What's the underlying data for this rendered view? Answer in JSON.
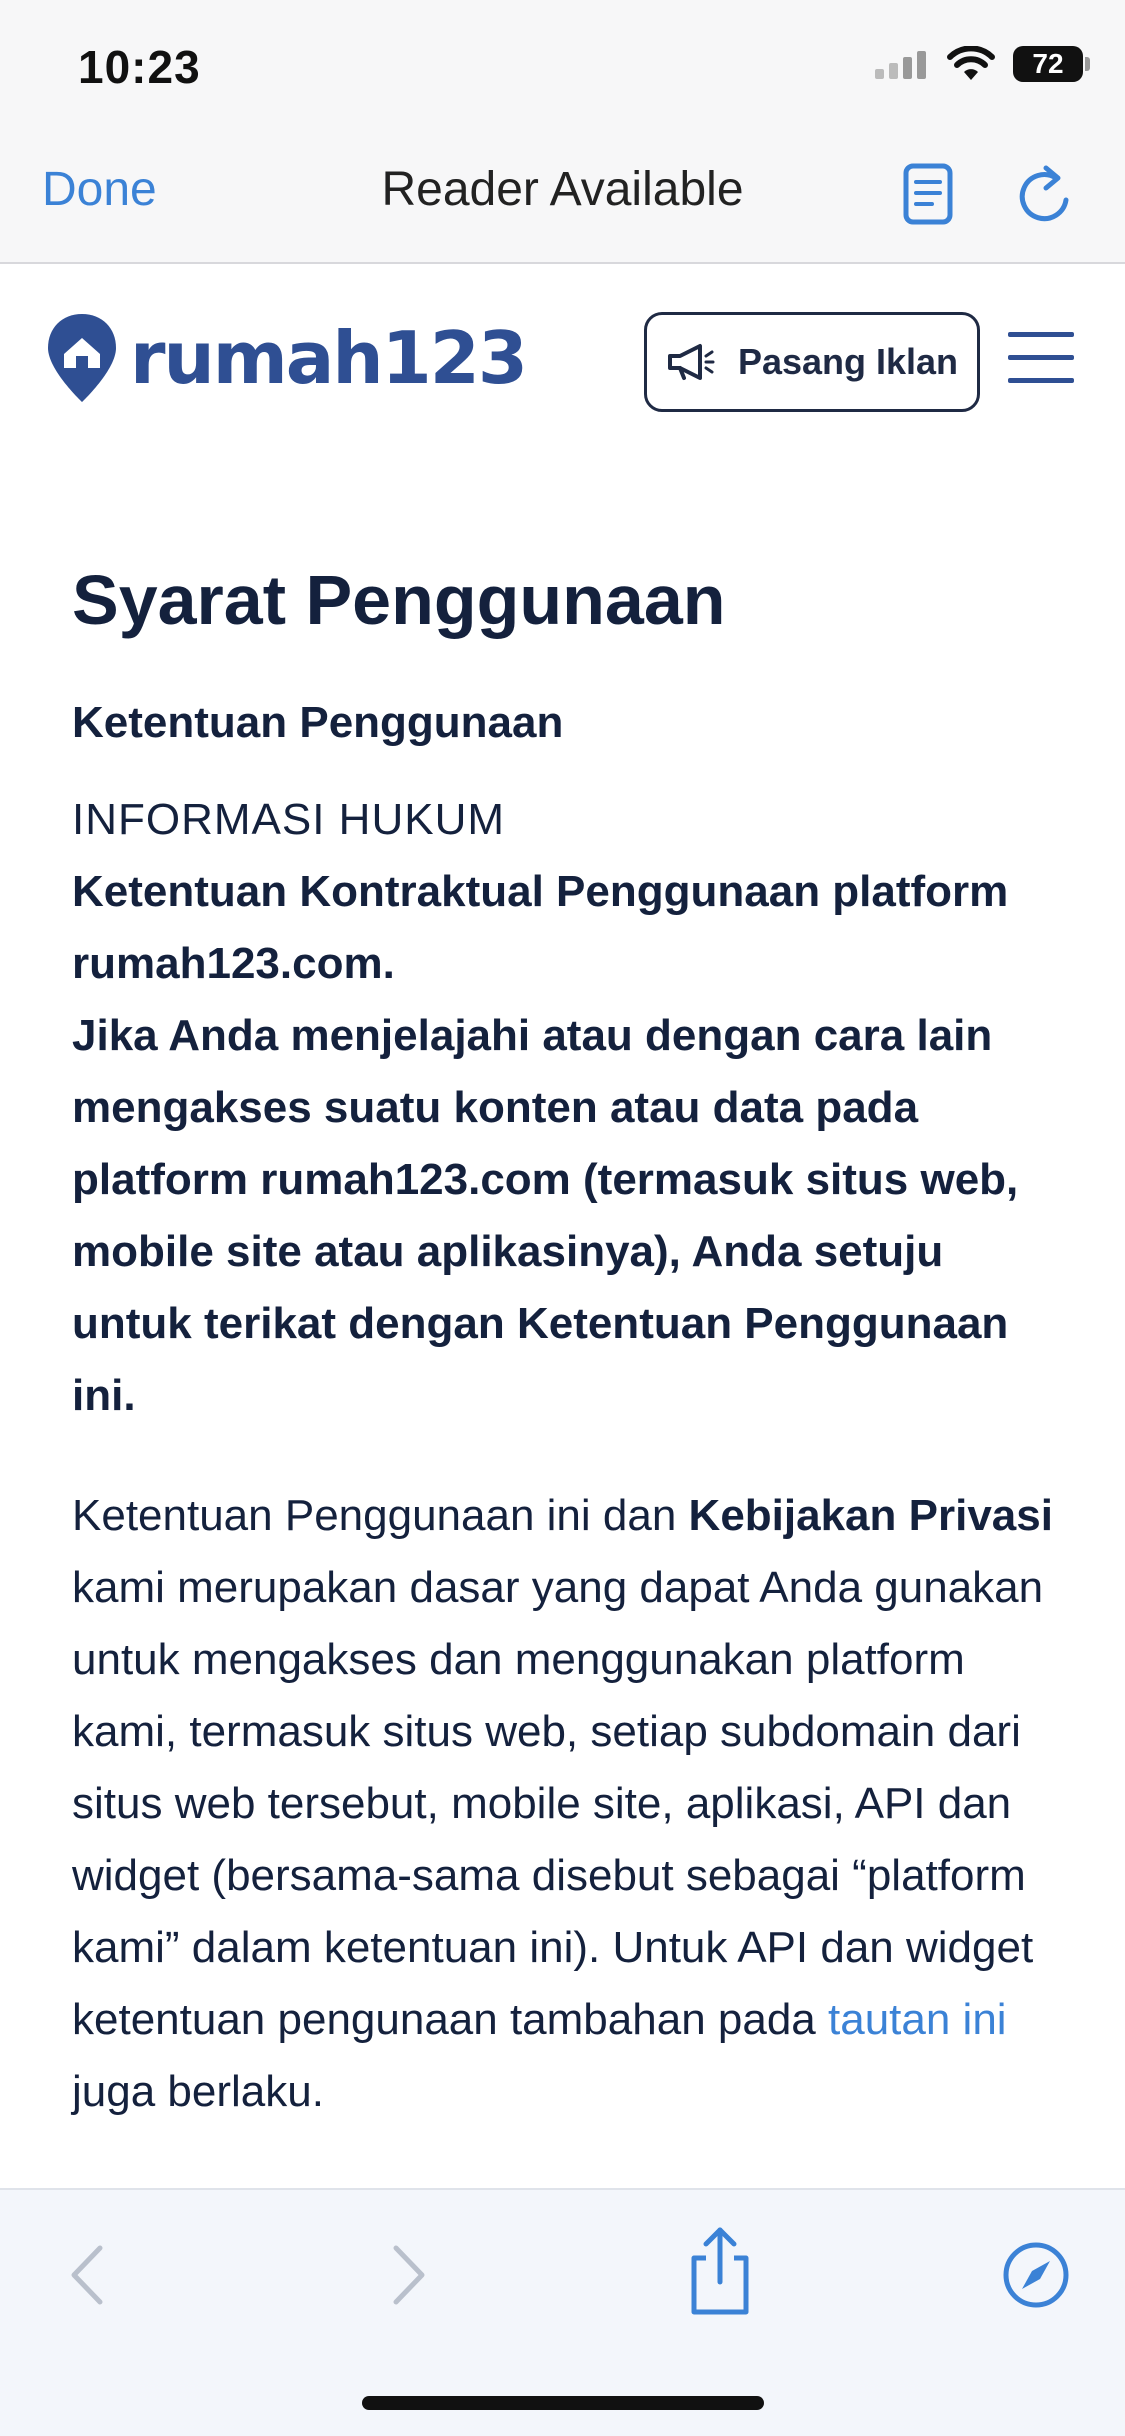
{
  "status_bar": {
    "time": "10:23",
    "battery": "72"
  },
  "browser_bar": {
    "done_label": "Done",
    "title": "Reader Available"
  },
  "site": {
    "logo_text": "rumah123",
    "ad_button_label": "Pasang Iklan"
  },
  "content": {
    "page_title": "Syarat Penggunaan",
    "section_title": "Ketentuan Penggunaan",
    "legal_head": "INFORMASI HUKUM",
    "contract_title": "Ketentuan Kontraktual Penggunaan platform rumah123.com.",
    "intro_bold": "Jika Anda menjelajahi atau dengan cara lain mengakses suatu konten atau data pada platform rumah123.com (termasuk situs web, mobile site atau aplikasinya), Anda setuju untuk terikat dengan Ketentuan Penggunaan ini.",
    "para1_start": "Ketentuan Penggunaan ini dan ",
    "para1_bold": "Kebijakan Privasi",
    "para1_mid": " kami merupakan dasar yang dapat Anda gunakan untuk mengakses dan menggunakan platform kami, termasuk situs web, setiap subdomain dari situs web tersebut, mobile site, aplikasi, API dan widget (bersama-sama disebut sebagai “platform kami” dalam ketentuan ini). Untuk API dan widget ketentuan pengunaan tambahan pada ",
    "para1_link": "tautan ini",
    "para1_end": " juga berlaku."
  },
  "colors": {
    "accent": "#3b82d6",
    "brand": "#2f4f93",
    "text": "#14213d"
  }
}
